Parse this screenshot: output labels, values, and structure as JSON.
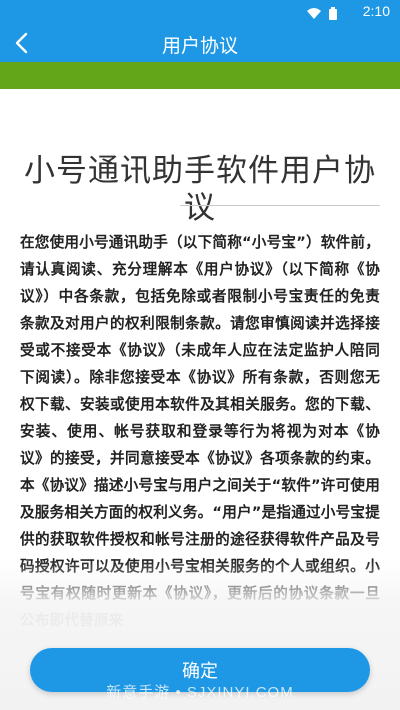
{
  "status_bar": {
    "time": "2:10"
  },
  "header": {
    "title": "用户协议"
  },
  "document": {
    "title": "小号通讯助手软件用户协议",
    "body": "在您使用小号通讯助手（以下简称“小号宝”）软件前，请认真阅读、充分理解本《用户协议》（以下简称《协议》）中各条款，包括免除或者限制小号宝责任的免责条款及对用户的权利限制条款。请您审慎阅读并选择接受或不接受本《协议》（未成年人应在法定监护人陪同下阅读）。除非您接受本《协议》所有条款，否则您无权下载、安装或使用本软件及其相关服务。您的下载、安装、使用、帐号获取和登录等行为将视为对本《协议》的接受，并同意接受本《协议》各项条款的约束。本《协议》描述小号宝与用户之间关于“软件”许可使用及服务相关方面的权利义务。“用户”是指通过小号宝提供的获取软件授权和帐号注册的途径获得软件产品及号码授权许可以及使用小号宝相关服务的个人或组织。小号宝有权随时更新本《协议》，更新后的协议条款一旦公布即代替原来"
  },
  "footer": {
    "confirm_label": "确定",
    "watermark": "新意手游 • SJXINYI.COM"
  },
  "colors": {
    "primary": "#1e98e4",
    "accent_band": "#64a619"
  },
  "icons": {
    "back": "chevron-left-icon",
    "wifi": "wifi-icon",
    "battery": "battery-icon"
  }
}
